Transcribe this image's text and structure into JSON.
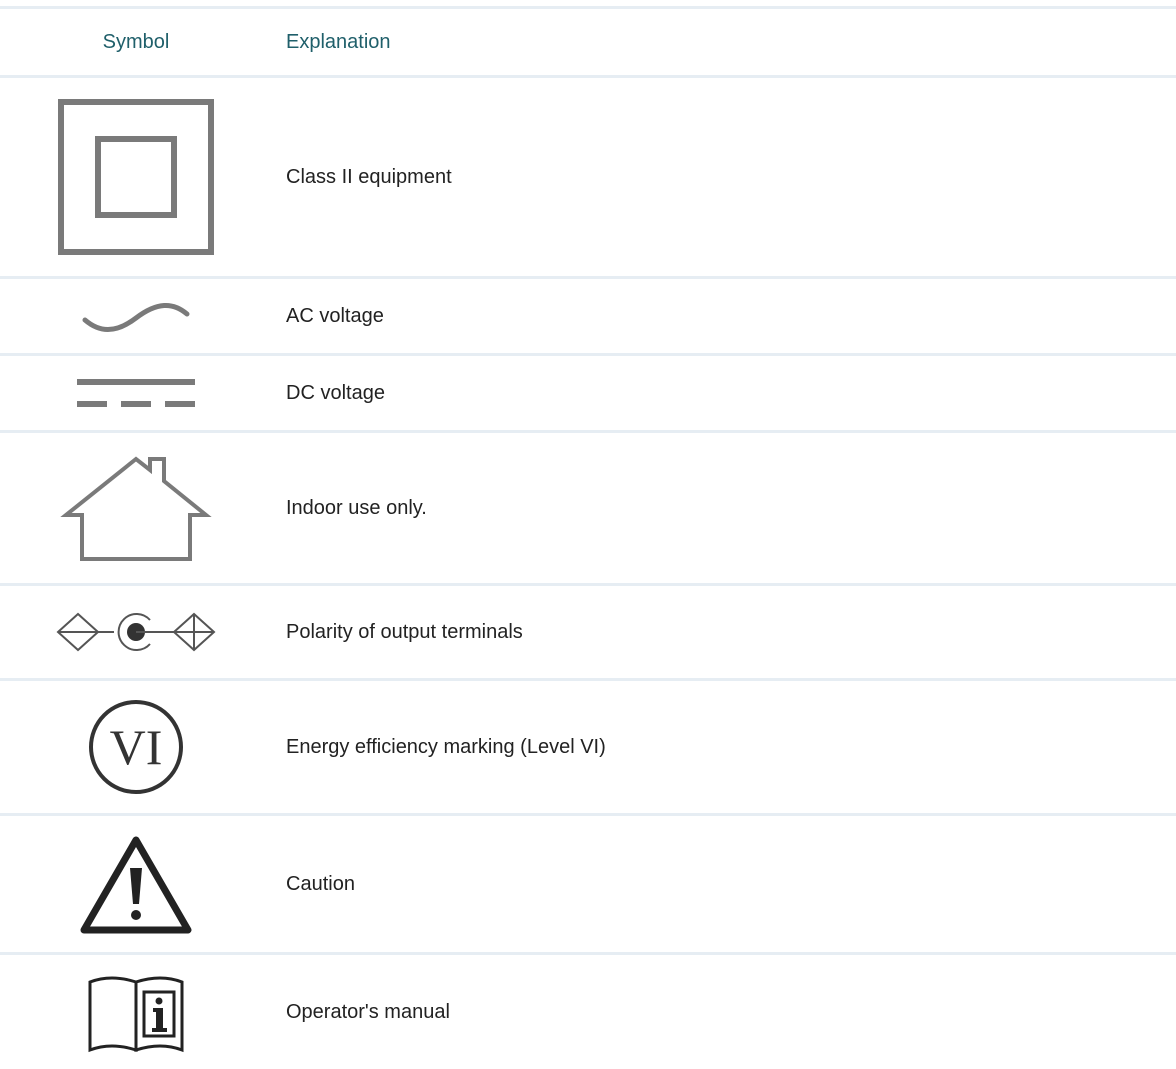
{
  "table": {
    "header": {
      "symbol": "Symbol",
      "explanation": "Explanation"
    },
    "rows": [
      {
        "icon": "class-ii-double-square-icon",
        "explanation": "Class II equipment"
      },
      {
        "icon": "ac-sine-wave-icon",
        "explanation": "AC voltage"
      },
      {
        "icon": "dc-voltage-icon",
        "explanation": "DC voltage"
      },
      {
        "icon": "indoor-house-icon",
        "explanation": "Indoor use only."
      },
      {
        "icon": "polarity-terminals-icon",
        "explanation": "Polarity of output terminals"
      },
      {
        "icon": "energy-efficiency-vi-icon",
        "symbol_text": "VI",
        "explanation": "Energy efficiency marking (Level VI)"
      },
      {
        "icon": "caution-triangle-icon",
        "explanation": "Caution"
      },
      {
        "icon": "operator-manual-book-icon",
        "explanation": "Operator's manual"
      }
    ]
  },
  "colors": {
    "header_text": "#1f5f6a",
    "body_text": "#222222",
    "divider": "#e6edf3",
    "symbol_gray": "#7a7a7a",
    "symbol_dark": "#333333"
  }
}
